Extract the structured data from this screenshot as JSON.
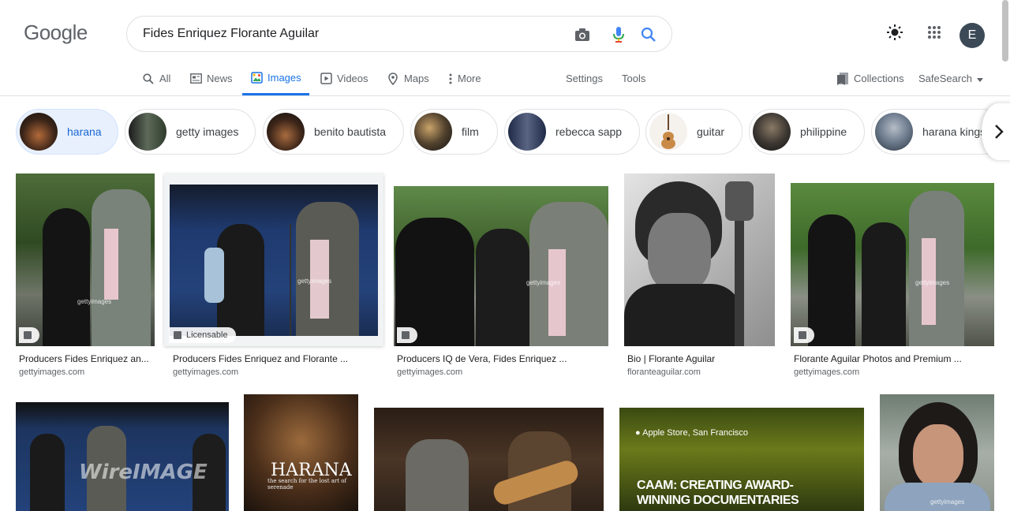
{
  "header": {
    "logo": "Google",
    "search_value": "Fides Enriquez Florante Aguilar",
    "avatar_letter": "E"
  },
  "tabs": [
    {
      "label": "All",
      "icon": "search-icon"
    },
    {
      "label": "News",
      "icon": "news-icon"
    },
    {
      "label": "Images",
      "icon": "images-icon",
      "active": true
    },
    {
      "label": "Videos",
      "icon": "play-icon"
    },
    {
      "label": "Maps",
      "icon": "map-pin-icon"
    },
    {
      "label": "More",
      "icon": "more-vert-icon"
    }
  ],
  "tools": {
    "settings": "Settings",
    "tools": "Tools",
    "collections": "Collections",
    "safesearch": "SafeSearch"
  },
  "chips": [
    {
      "label": "harana",
      "selected": true
    },
    {
      "label": "getty images"
    },
    {
      "label": "benito bautista"
    },
    {
      "label": "film"
    },
    {
      "label": "rebecca sapp"
    },
    {
      "label": "guitar"
    },
    {
      "label": "philippine"
    },
    {
      "label": "harana kings"
    }
  ],
  "results": [
    {
      "title": "Producers Fides Enriquez an...",
      "source": "gettyimages.com"
    },
    {
      "title": "Producers Fides Enriquez and Florante ...",
      "source": "gettyimages.com",
      "badge": "Licensable"
    },
    {
      "title": "Producers IQ de Vera, Fides Enriquez ...",
      "source": "gettyimages.com"
    },
    {
      "title": "Bio | Florante Aguilar",
      "source": "floranteaguilar.com"
    },
    {
      "title": "Florante Aguilar Photos and Premium ...",
      "source": "gettyimages.com"
    }
  ],
  "row2_overlays": {
    "wireimage": "WireIMAGE",
    "harana_title": "HARANA",
    "harana_sub": "the search for the lost art of serenade",
    "apple_store": "Apple Store, San Francisco",
    "caam_line1": "CAAM: CREATING AWARD-",
    "caam_line2": "WINNING DOCUMENTARIES"
  },
  "watermarks": {
    "getty": "gettyimages"
  },
  "colors": {
    "accent": "#1a73e8",
    "chip_selected_bg": "#e8f0fe"
  }
}
